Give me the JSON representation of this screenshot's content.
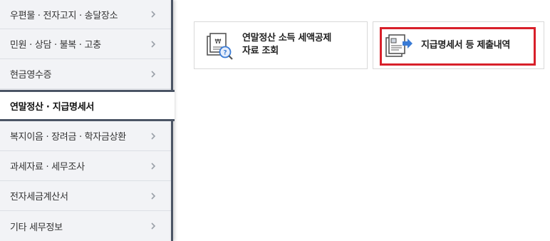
{
  "sidebar": {
    "items": [
      {
        "label": "우편물 · 전자고지 · 송달장소",
        "active": false
      },
      {
        "label": "민원 · 상담 · 불복 · 고충",
        "active": false
      },
      {
        "label": "현금영수증",
        "active": false
      },
      {
        "label": "연말정산 · 지급명세서",
        "active": true
      },
      {
        "label": "복지이음 · 장려금 · 학자금상환",
        "active": false
      },
      {
        "label": "과세자료 · 세무조사",
        "active": false
      },
      {
        "label": "전자세금계산서",
        "active": false
      },
      {
        "label": "기타 세무정보",
        "active": false
      }
    ]
  },
  "cards": [
    {
      "label_line1": "연말정산 소득 세액공제",
      "label_line2": "자료 조회",
      "icon": "tax-document-search-icon"
    },
    {
      "label_line1": "지급명세서 등 제출내역",
      "label_line2": "",
      "icon": "document-submit-icon"
    }
  ],
  "colors": {
    "highlight": "#d8202a",
    "sidebar_bg": "#f2f3f6",
    "active_border": "#4b5565",
    "icon_accent": "#3a7bd5"
  }
}
